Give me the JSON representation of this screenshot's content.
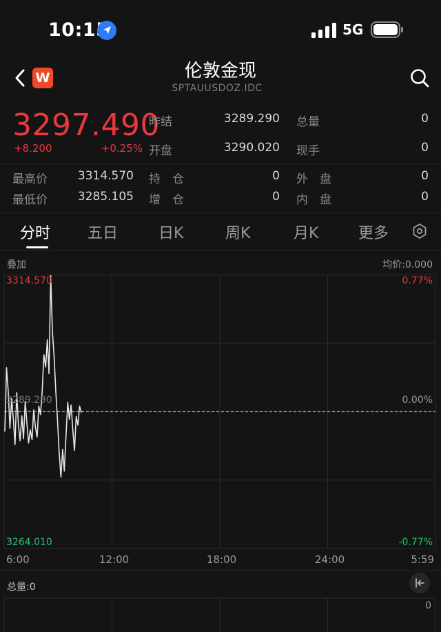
{
  "status": {
    "time": "10:15",
    "network": "5G"
  },
  "nav": {
    "title": "伦敦金现",
    "subtitle": "SPTAUUSDOZ.IDC",
    "logo_letter": "W"
  },
  "quote": {
    "price": "3297.490",
    "change": "+8.200",
    "change_pct": "+0.25%",
    "prev_close_label": "昨结",
    "prev_close": "3289.290",
    "total_vol_label": "总量",
    "total_vol": "0",
    "open_label": "开盘",
    "open": "3290.020",
    "current_hand_label": "现手",
    "current_hand": "0",
    "high_label": "最高价",
    "high": "3314.570",
    "hold_label": "持　仓",
    "hold": "0",
    "outer_label": "外　盘",
    "outer": "0",
    "low_label": "最低价",
    "low": "3285.105",
    "add_label": "增　仓",
    "add": "0",
    "inner_label": "内　盘",
    "inner": "0"
  },
  "tabs": [
    "分时",
    "五日",
    "日K",
    "周K",
    "月K",
    "更多"
  ],
  "chart": {
    "overlay_label": "叠加",
    "avg_label": "均价:0.000",
    "y_top": "3314.570",
    "y_mid": "3289.290",
    "y_bottom": "3264.010",
    "pct_top": "0.77%",
    "pct_mid": "0.00%",
    "pct_bottom": "-0.77%",
    "x_ticks": [
      "6:00",
      "12:00",
      "18:00",
      "24:00",
      "5:59"
    ]
  },
  "volume": {
    "label": "总量:0",
    "zero": "0"
  },
  "colors": {
    "up": "#e8393f",
    "down": "#2fbf71",
    "line": "#e6e6e6",
    "ref": "#e8782d"
  },
  "chart_data": {
    "type": "line",
    "y_axis_range": [
      3264.01,
      3314.57
    ],
    "reference_line": 3289.29,
    "x_axis_hours": [
      6,
      30
    ],
    "series": [
      {
        "values": [
          3285.6,
          3297.4,
          3293.1,
          3286.2,
          3291.7,
          3288.0,
          3283.2,
          3292.8,
          3286.9,
          3283.9,
          3288.5,
          3284.3,
          3291.2,
          3287.1,
          3283.5,
          3285.9,
          3284.1,
          3289.6,
          3286.4,
          3284.6,
          3290.3,
          3288.7,
          3293.2,
          3299.8,
          3297.5,
          3302.6,
          3296.3,
          3314.4,
          3303.9,
          3299.5,
          3293.0,
          3287.6,
          3281.7,
          3277.2,
          3282.3,
          3278.3,
          3284.9,
          3291.0,
          3287.8,
          3290.5,
          3285.8,
          3282.1,
          3288.4,
          3286.8,
          3290.3,
          3289.1
        ]
      }
    ]
  }
}
